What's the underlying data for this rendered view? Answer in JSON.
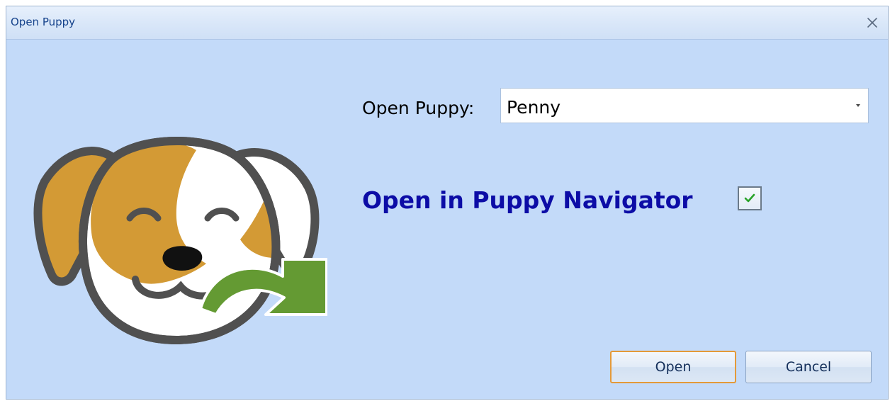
{
  "window": {
    "title": "Open Puppy"
  },
  "form": {
    "puppy_label": "Open Puppy:",
    "puppy_selected": "Penny",
    "navigator_label": "Open in Puppy Navigator",
    "navigator_checked": true
  },
  "buttons": {
    "open_label": "Open",
    "cancel_label": "Cancel"
  },
  "icons": {
    "close": "close-icon",
    "dropdown": "chevron-down-icon",
    "check": "check-icon",
    "logo": "puppy-logo-icon"
  },
  "colors": {
    "window_bg": "#c3daf9",
    "title_text": "#15428b",
    "navigator_text": "#0c0ca6",
    "default_button_border": "#e49a39",
    "check_mark": "#29a329",
    "dog_orange": "#d39a35",
    "dog_outline": "#505050",
    "arrow_green": "#649a33"
  }
}
